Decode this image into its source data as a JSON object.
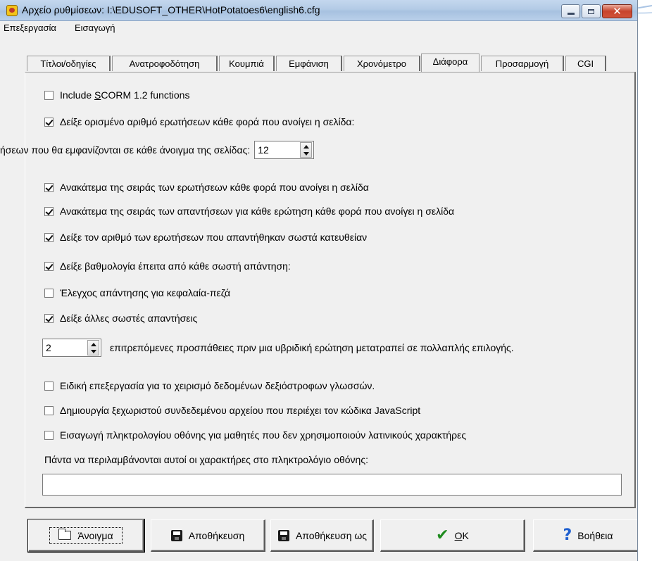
{
  "window": {
    "title": "Αρχείο ρυθμίσεων: I:\\EDUSOFT_OTHER\\HotPotatoes6\\english6.cfg"
  },
  "menu": [
    "Επεξεργασία",
    "Εισαγωγή"
  ],
  "tabs": [
    {
      "label": "Τίτλοι/οδηγίες",
      "active": false
    },
    {
      "label": "Ανατροφοδότηση",
      "active": false
    },
    {
      "label": "Κουμπιά",
      "active": false
    },
    {
      "label": "Εμφάνιση",
      "active": false
    },
    {
      "label": "Χρονόμετρο",
      "active": false
    },
    {
      "label": "Διάφορα",
      "active": true
    },
    {
      "label": "Προσαρμογή",
      "active": false
    },
    {
      "label": "CGI",
      "active": false
    }
  ],
  "options": {
    "scorm": {
      "label_pre": "Include ",
      "label_ul": "S",
      "label_post": "CORM 1.2 functions",
      "checked": false
    },
    "show_fixed_number": {
      "label": "Δείξε ορισμένο αριθμό ερωτήσεων κάθε φορά που ανοίγει η σελίδα:",
      "checked": true
    },
    "questions_per_page": {
      "label": "ήσεων που θα εμφανίζονται σε κάθε άνοιγμα της σελίδας:",
      "value": "12"
    },
    "shuffle_questions": {
      "label": "Ανακάτεμα της σειράς των ερωτήσεων κάθε φορά που ανοίγει η σελίδα",
      "checked": true
    },
    "shuffle_answers": {
      "label": "Ανακάτεμα της σειράς των απαντήσεων για κάθε ερώτηση κάθε φορά που ανοίγει η σελίδα",
      "checked": true
    },
    "show_correct_count": {
      "label": "Δείξε τον αριθμό των ερωτήσεων που απαντήθηκαν σωστά κατευθείαν",
      "checked": true
    },
    "show_score_after": {
      "label": "Δείξε βαθμολογία έπειτα από κάθε σωστή απάντηση:",
      "checked": true
    },
    "case_check": {
      "label": "Έλεγχος απάντησης για κεφαλαία-πεζά",
      "checked": false
    },
    "show_other_correct": {
      "label": "Δείξε άλλες σωστές απαντήσεις",
      "checked": true
    },
    "attempts": {
      "value": "2",
      "label": "επιτρεπόμενες προσπάθειες πριν μια υβριδική ερώτηση μετατραπεί σε πολλαπλής επιλογής."
    },
    "rtl": {
      "label": "Ειδική επεξεργασία για το χειρισμό δεδομένων δεξιόστροφων γλωσσών.",
      "checked": false
    },
    "separate_js": {
      "label": "Δημιουργία ξεχωριστού συνδεδεμένου αρχείου που περιέχει τον κώδικα JavaScript",
      "checked": false
    },
    "onscreen_keyboard": {
      "label": "Εισαγωγή πληκτρολογίου οθόνης για μαθητές που δεν χρησιμοποιούν λατινικούς χαρακτήρες",
      "checked": false
    },
    "keyboard_chars_label": "Πάντα να περιλαμβάνονται αυτοί οι χαρακτήρες στο πληκτρολόγιο οθόνης:",
    "keyboard_chars_value": ""
  },
  "buttons": {
    "open": "Άνοιγμα",
    "save": "Αποθήκευση",
    "save_as": "Αποθήκευση ως",
    "ok_ul": "O",
    "ok_rest": "K",
    "help": "Βοήθεια"
  },
  "icons": {
    "app": "hotpotatoes-icon",
    "open": "folder-open-icon",
    "save": "floppy-disk-icon",
    "save_as": "floppy-disk-as-icon",
    "ok": "checkmark-icon",
    "help": "question-mark-icon"
  },
  "colors": {
    "dialog_bg": "#f0f0f0",
    "titlebar": "#b3cbe6",
    "close_button": "#c7442d",
    "ok_check": "#1f8b1f",
    "help_mark": "#1f5fcf"
  }
}
